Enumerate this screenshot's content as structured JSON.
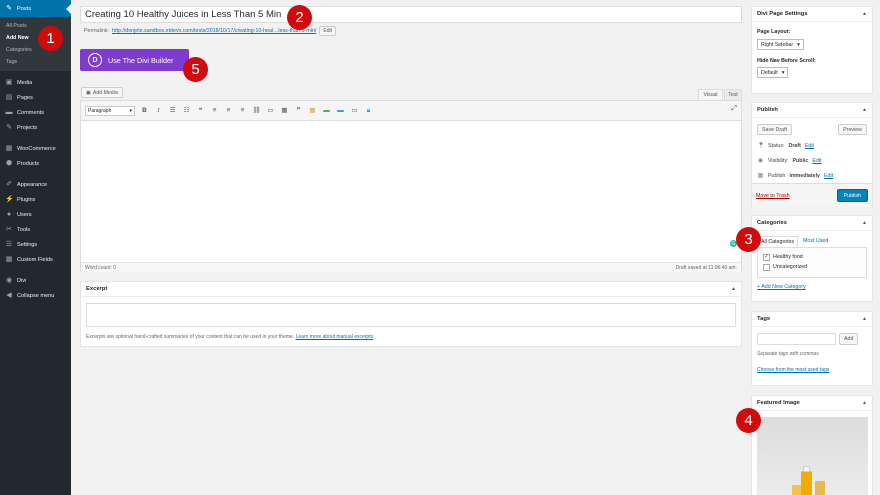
{
  "sidebar": {
    "posts": "Posts",
    "sub": [
      "All Posts",
      "Add New",
      "Categories",
      "Tags"
    ],
    "items": [
      "Media",
      "Pages",
      "Comments",
      "Projects",
      "WooCommerce",
      "Products",
      "Appearance",
      "Plugins",
      "Users",
      "Tools",
      "Settings",
      "Custom Fields",
      "Divi",
      "Collapse menu"
    ]
  },
  "editor": {
    "title": "Creating 10 Healthy Juices in Less Than 5 Min",
    "permalink_label": "Permalink:",
    "permalink_url": "http://donjete.sandbox.etdevs.com/tests/2018/10/17/creating-10-heal…less-than-5-min/",
    "edit_label": "Edit",
    "divi_logo": "D",
    "divi_button": "Use The Divi Builder",
    "add_media": "Add Media",
    "tab_visual": "Visual",
    "tab_text": "Text",
    "format_select": "Paragraph",
    "word_count": "Word count: 0",
    "draft_saved": "Draft saved at 11:06:40 am."
  },
  "excerpt": {
    "title": "Excerpt",
    "help": "Excerpts are optional hand-crafted summaries of your content that can be used in your theme.",
    "help_link": "Learn more about manual excerpts"
  },
  "divi_settings": {
    "title": "Divi Page Settings",
    "layout_label": "Page Layout:",
    "layout_value": "Right Sidebar",
    "hide_nav_label": "Hide Nav Before Scroll:",
    "hide_nav_value": "Default"
  },
  "publish": {
    "title": "Publish",
    "save_draft": "Save Draft",
    "preview": "Preview",
    "status_label": "Status:",
    "status_value": "Draft",
    "visibility_label": "Visibility:",
    "visibility_value": "Public",
    "publish_label": "Publish",
    "publish_value": "immediately",
    "edit": "Edit",
    "trash": "Move to Trash",
    "publish_button": "Publish"
  },
  "categories": {
    "title": "Categories",
    "tab_all": "All Categories",
    "tab_used": "Most Used",
    "items": [
      {
        "label": "Healthy food",
        "checked": true
      },
      {
        "label": "Uncategorized",
        "checked": false
      }
    ],
    "add_new": "+ Add New Category"
  },
  "tags": {
    "title": "Tags",
    "add_button": "Add",
    "help": "Separate tags with commas",
    "choose": "Choose from the most used tags"
  },
  "featured": {
    "title": "Featured Image"
  },
  "annotations": [
    "1",
    "2",
    "3",
    "4",
    "5"
  ],
  "colors": {
    "sidebar_bg": "#23282d",
    "active_blue": "#0073aa",
    "divi_purple": "#7e3bd0",
    "badge_red": "#d10b0b",
    "publish_blue": "#0085ba"
  }
}
